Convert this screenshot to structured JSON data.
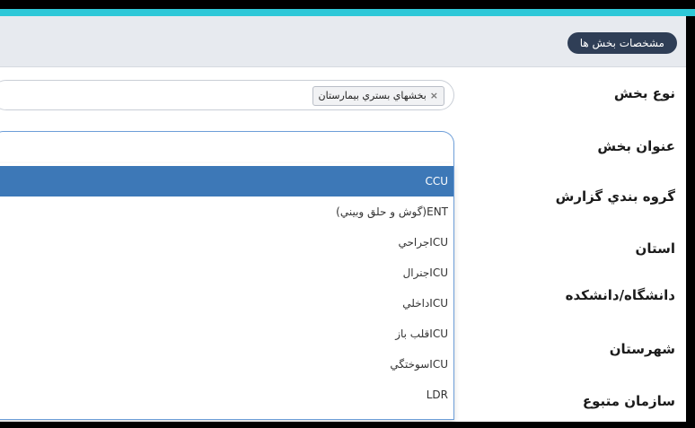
{
  "header": {
    "section_button": "مشخصات بخش ها"
  },
  "labels": {
    "ward_type": "نوع بخش",
    "ward_title": "عنوان بخش",
    "report_group": "گروه بندي گزارش",
    "province": "استان",
    "university": "دانشگاه/دانشكده",
    "city": "شهرستان",
    "affiliated_org": "سازمان متبوع"
  },
  "ward_type_field": {
    "tag": "بخشهاي بستري بيمارستان",
    "remove_icon": "×"
  },
  "ward_title_field": {
    "value": ""
  },
  "dropdown": {
    "options": [
      "CCU",
      "ENT(گوش و حلق وبيني)",
      "ICUجراحي",
      "ICUجنرال",
      "ICUداخلي",
      "ICUقلب باز",
      "ICUسوختگي",
      "LDR"
    ],
    "selected_index": 0
  }
}
